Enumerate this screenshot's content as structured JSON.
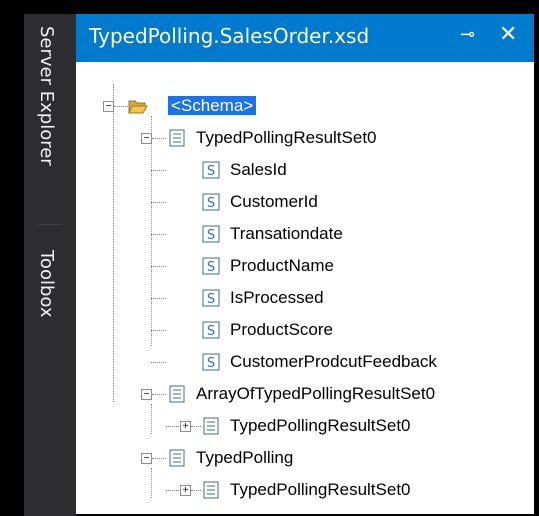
{
  "sidebar": {
    "tabs": [
      {
        "label": "Server Explorer"
      },
      {
        "label": "Toolbox"
      }
    ]
  },
  "document_tab": {
    "title": "TypedPolling.SalesOrder.xsd",
    "pin_glyph": "⊸",
    "close_glyph": "✕"
  },
  "tree": {
    "root": {
      "label": "<Schema>",
      "expander": "−",
      "icon": "folder-open-icon"
    },
    "nodes": [
      {
        "label": "TypedPollingResultSet0",
        "expander": "−",
        "icon": "element-icon"
      },
      {
        "label": "SalesId",
        "icon": "attribute-icon"
      },
      {
        "label": "CustomerId",
        "icon": "attribute-icon"
      },
      {
        "label": "Transationdate",
        "icon": "attribute-icon"
      },
      {
        "label": "ProductName",
        "icon": "attribute-icon"
      },
      {
        "label": "IsProcessed",
        "icon": "attribute-icon"
      },
      {
        "label": "ProductScore",
        "icon": "attribute-icon"
      },
      {
        "label": "CustomerProdcutFeedback",
        "icon": "attribute-icon"
      },
      {
        "label": "ArrayOfTypedPollingResultSet0",
        "expander": "−",
        "icon": "element-icon"
      },
      {
        "label": "TypedPollingResultSet0",
        "expander": "+",
        "icon": "element-icon"
      },
      {
        "label": "TypedPolling",
        "expander": "−",
        "icon": "element-icon"
      },
      {
        "label": "TypedPollingResultSet0",
        "expander": "+",
        "icon": "element-icon"
      }
    ]
  },
  "colors": {
    "accent": "#007acc",
    "selection": "#1a73e8",
    "sidebar_bg": "#2d2d30"
  }
}
